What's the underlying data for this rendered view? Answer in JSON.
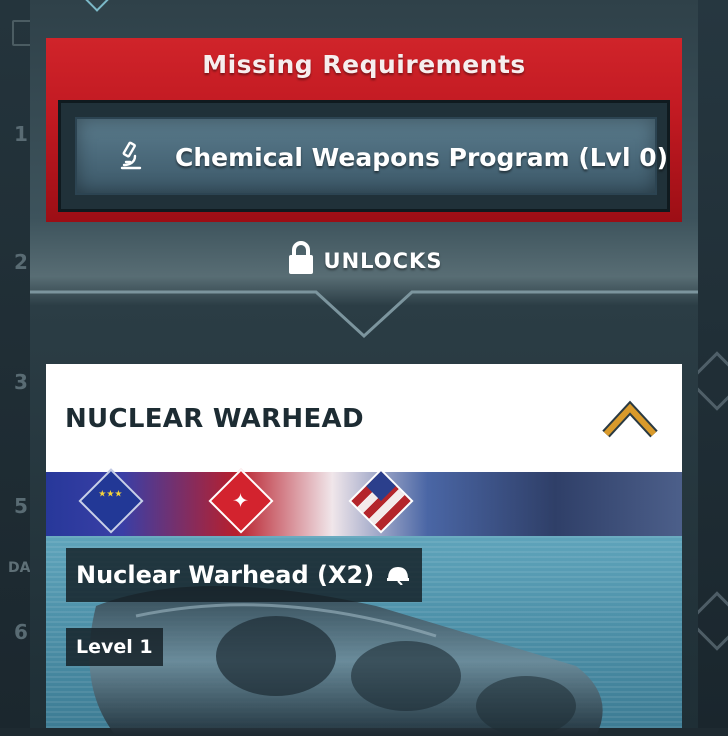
{
  "background": {
    "row_numbers": [
      "1",
      "2",
      "3",
      "5",
      "6"
    ],
    "side_label": "DA"
  },
  "requirements": {
    "title": "Missing Requirements",
    "items": [
      {
        "label": "Chemical Weapons Program (Lvl 0)",
        "icon": "microscope-icon"
      }
    ]
  },
  "unlocks": {
    "label": "UNLOCKS",
    "icon": "lock-icon"
  },
  "card": {
    "title": "NUCLEAR WARHEAD",
    "rank_icon": "chevron-rank-icon",
    "factions": [
      "eu-badge",
      "red-star-badge",
      "us-badge"
    ],
    "item_name": "Nuclear Warhead (X2)",
    "item_icon": "helmet-icon",
    "level": "Level 1"
  },
  "colors": {
    "alert_red": "#c21a22",
    "panel_dark": "#203139",
    "rank_orange": "#d99a2b"
  }
}
